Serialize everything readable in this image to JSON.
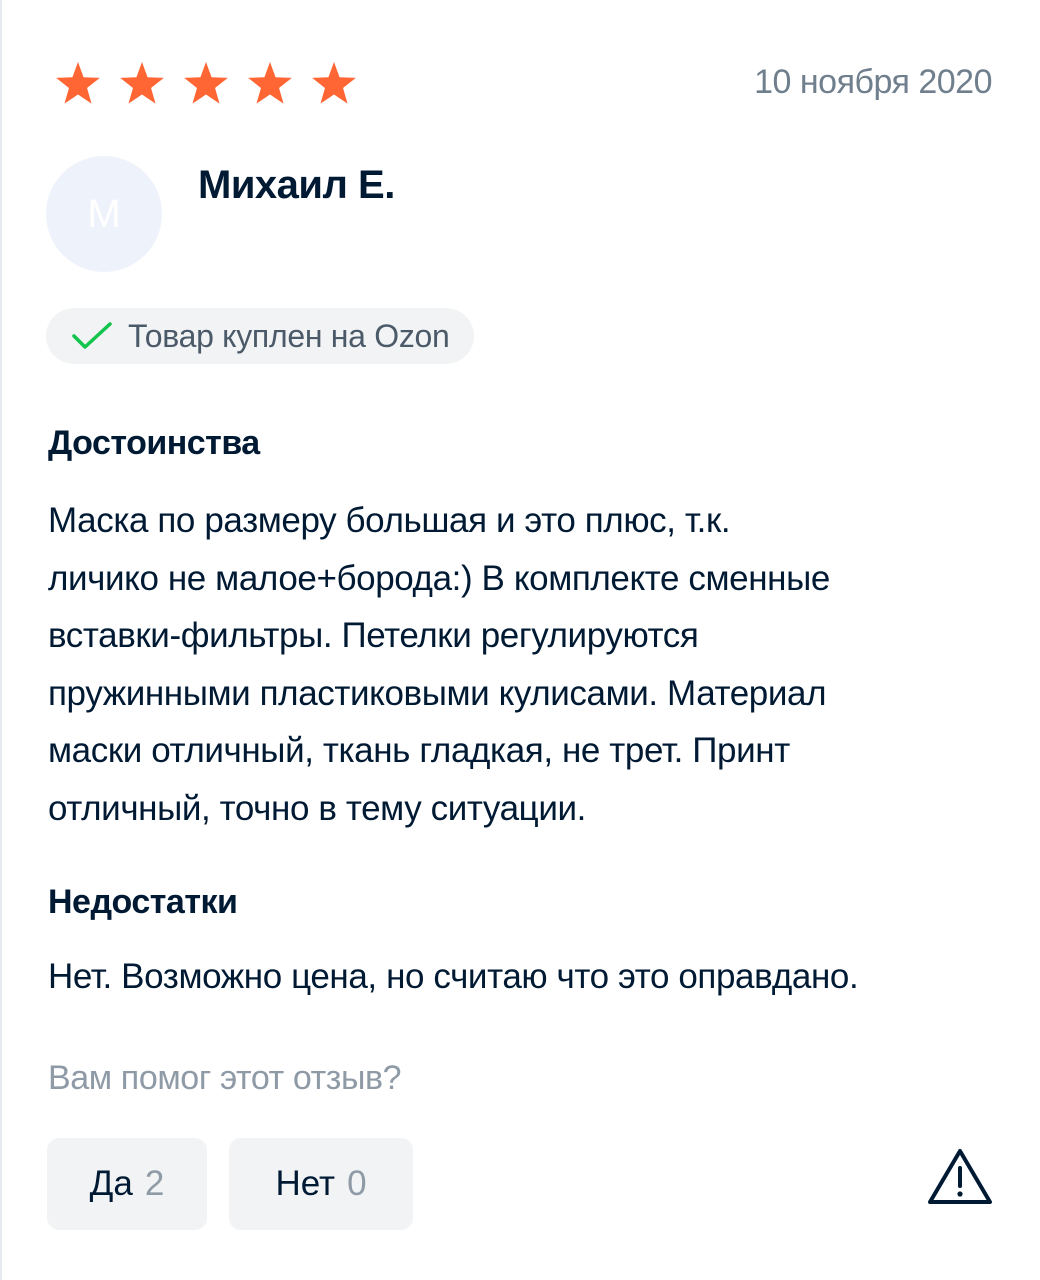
{
  "review": {
    "rating": 5,
    "rating_max": 5,
    "date": "10 ноября 2020",
    "author": {
      "initial": "М",
      "name": "Михаил Е."
    },
    "purchase_badge": "Товар куплен на Ozon",
    "pros": {
      "heading": "Достоинства",
      "lines": [
        "Маска по размеру большая и это плюс, т.к.",
        "личико не малое+борода:) В комплекте сменные",
        "вставки-фильтры. Петелки регулируются",
        "пружинными пластиковыми кулисами. Материал",
        "маски отличный, ткань гладкая, не трет. Принт",
        "отличный, точно в тему ситуации."
      ]
    },
    "cons": {
      "heading": "Недостатки",
      "text": "Нет. Возможно цена, но считаю что это оправдано."
    }
  },
  "feedback": {
    "question": "Вам помог этот отзыв?",
    "yes_label": "Да",
    "yes_count": "2",
    "no_label": "Нет",
    "no_count": "0"
  },
  "icons": {
    "star": "star-icon",
    "check": "check-icon",
    "report": "warning-triangle-icon"
  },
  "colors": {
    "star": "#ff6633",
    "check": "#10c44c",
    "text_primary": "#001a34",
    "text_secondary": "#707f8d",
    "button_bg": "#f2f3f5",
    "avatar_bg": "#eef2fb"
  }
}
